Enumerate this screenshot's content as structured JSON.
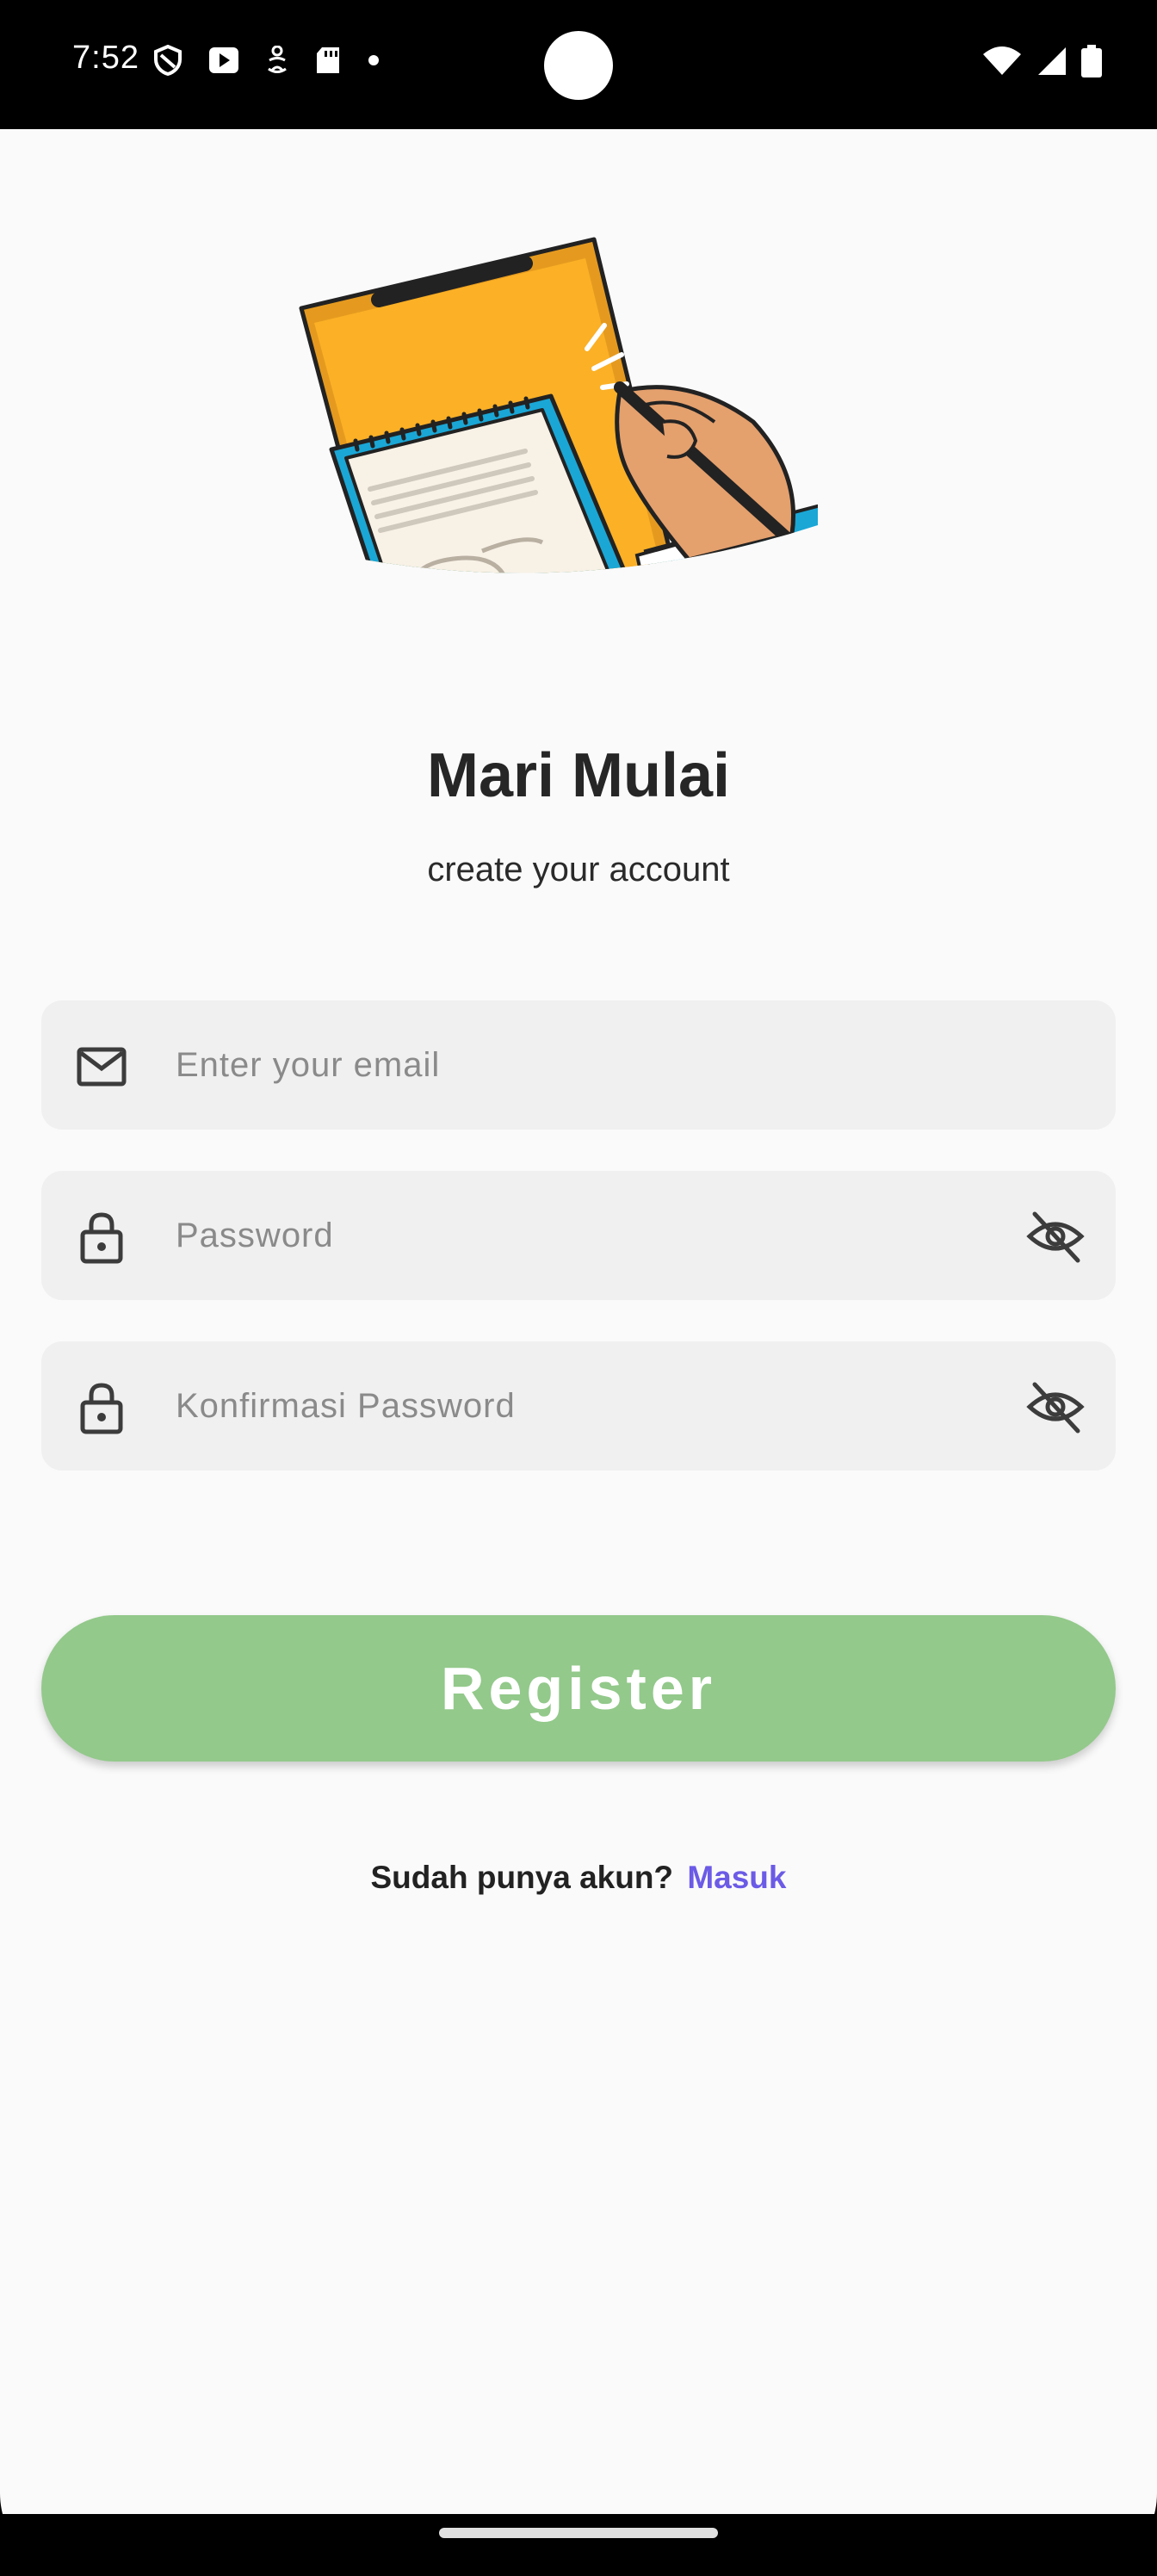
{
  "status_bar": {
    "time": "7:52",
    "left_icons": [
      "shield-icon",
      "play-store-icon",
      "accessibility-icon",
      "sd-card-icon",
      "dot-icon"
    ],
    "right_icons": [
      "wifi-icon",
      "signal-icon",
      "battery-icon"
    ]
  },
  "header": {
    "title": "Mari Mulai",
    "subtitle": "create your account"
  },
  "form": {
    "email": {
      "placeholder": "Enter your email",
      "value": "",
      "icon": "mail-icon"
    },
    "password": {
      "placeholder": "Password",
      "value": "",
      "icon": "lock-icon",
      "toggle_icon": "eye-off-icon"
    },
    "confirm_password": {
      "placeholder": "Konfirmasi Password",
      "value": "",
      "icon": "lock-icon",
      "toggle_icon": "eye-off-icon"
    },
    "register_label": "Register"
  },
  "footer": {
    "prompt": "Sudah punya akun?",
    "login_link": "Masuk"
  },
  "colors": {
    "background": "#fafafa",
    "field_bg": "#f0f0f0",
    "button": "#93c98b",
    "link": "#6b5be6",
    "title": "#262626"
  }
}
